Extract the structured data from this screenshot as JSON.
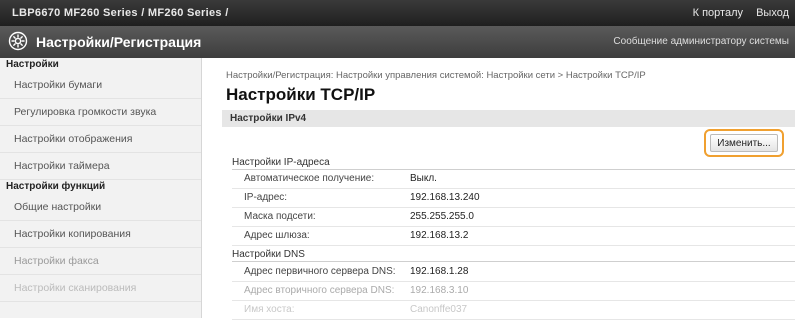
{
  "topbar": {
    "device": "LBP6670 MF260 Series / MF260 Series /",
    "portal_link": "К порталу",
    "logout_link": "Выход"
  },
  "titlebar": {
    "title": "Настройки/Регистрация",
    "admin_message": "Сообщение администратору системы"
  },
  "sidebar": {
    "section1": "Настройки",
    "items1": [
      "Настройки бумаги",
      "Регулировка громкости звука",
      "Настройки отображения",
      "Настройки таймера"
    ],
    "section2": "Настройки функций",
    "items2": [
      "Общие настройки",
      "Настройки копирования",
      "Настройки факса",
      "Настройки сканирования"
    ]
  },
  "main": {
    "breadcrumb": "Настройки/Регистрация: Настройки управления системой: Настройки сети > Настройки TCP/IP",
    "title": "Настройки TCP/IP",
    "section": "Настройки IPv4",
    "edit_button": "Изменить...",
    "ip_group": "Настройки IP-адреса",
    "ip_rows": [
      {
        "label": "Автоматическое получение:",
        "value": "Выкл."
      },
      {
        "label": "IP-адрес:",
        "value": "192.168.13.240"
      },
      {
        "label": "Маска подсети:",
        "value": "255.255.255.0"
      },
      {
        "label": "Адрес шлюза:",
        "value": "192.168.13.2"
      }
    ],
    "dns_group": "Настройки DNS",
    "dns_rows": [
      {
        "label": "Адрес первичного сервера DNS:",
        "value": "192.168.1.28"
      },
      {
        "label": "Адрес вторичного сервера DNS:",
        "value": "192.168.3.10"
      },
      {
        "label": "Имя хоста:",
        "value": "Canonffe037"
      }
    ]
  },
  "colors": {
    "highlight": "#f0a030"
  },
  "icons": {
    "logo": "settings-gear-icon"
  }
}
